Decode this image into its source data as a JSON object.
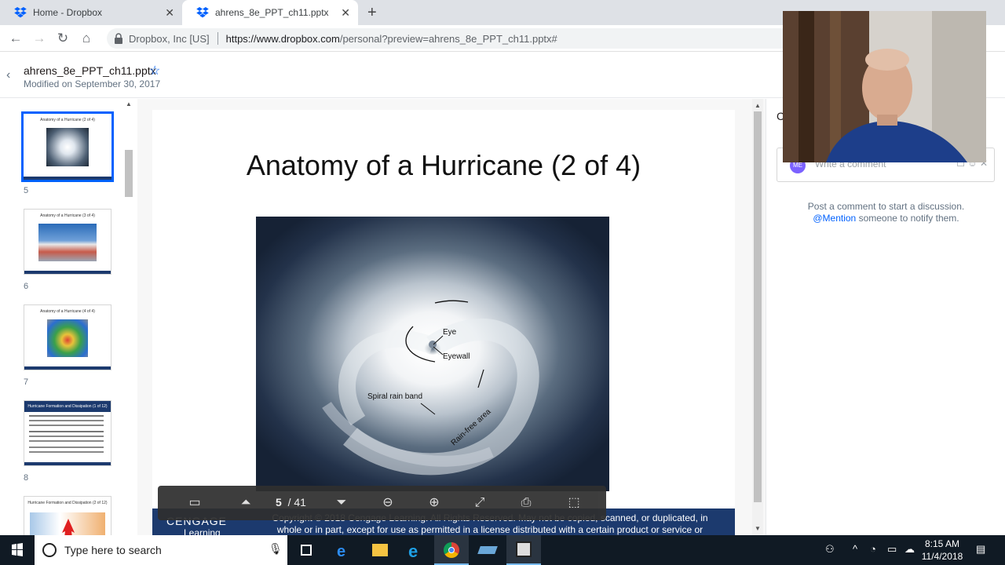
{
  "tabs": [
    {
      "label": "Home - Dropbox",
      "active": false
    },
    {
      "label": "ahrens_8e_PPT_ch11.pptx",
      "active": true
    }
  ],
  "address": {
    "org": "Dropbox, Inc [US]",
    "url_host": "https://www.dropbox.com",
    "url_path": "/personal?preview=ahrens_8e_PPT_ch11.pptx#"
  },
  "file": {
    "name": "ahrens_8e_PPT_ch11.pptx",
    "modified": "Modified on September 30, 2017"
  },
  "thumbnails": [
    {
      "num": "5",
      "title": "Anatomy of a Hurricane (2 of 4)",
      "selected": true
    },
    {
      "num": "6",
      "title": "Anatomy of a Hurricane (3 of 4)",
      "selected": false
    },
    {
      "num": "7",
      "title": "Anatomy of a Hurricane (4 of 4)",
      "selected": false
    },
    {
      "num": "8",
      "title": "Hurricane Formation and Dissipation (1 of 12)",
      "selected": false
    },
    {
      "num": "",
      "title": "Hurricane Formation and Dissipation (2 of 12)",
      "selected": false
    }
  ],
  "slide": {
    "title": "Anatomy of a Hurricane (2 of 4)",
    "labels": {
      "eye": "Eye",
      "eyewall": "Eyewall",
      "spiral": "Spiral rain band",
      "rainfree": "Rain-free area"
    },
    "footer": {
      "brand": "CENGAGE",
      "brand_sub": "Learning",
      "copyright": "Copyright © 2018 Cengage Learning. All Rights Reserved. May not be copied, scanned, or duplicated, in whole or in part, except for use as permitted in a license distributed with a certain product or service or"
    }
  },
  "viewer": {
    "current_page": "5",
    "total_pages": "/ 41"
  },
  "comments": {
    "heading": "C",
    "avatar": "ME",
    "placeholder": "Write a comment",
    "hint_line1": "Post a comment to start a discussion.",
    "mention": "@Mention",
    "hint_line2_rest": " someone to notify them."
  },
  "taskbar": {
    "search_placeholder": "Type here to search",
    "time": "8:15 AM",
    "date": "11/4/2018"
  },
  "colors": {
    "dropbox_blue": "#0061fe",
    "cengage_navy": "#1c3a6e",
    "taskbar": "#101a24"
  }
}
